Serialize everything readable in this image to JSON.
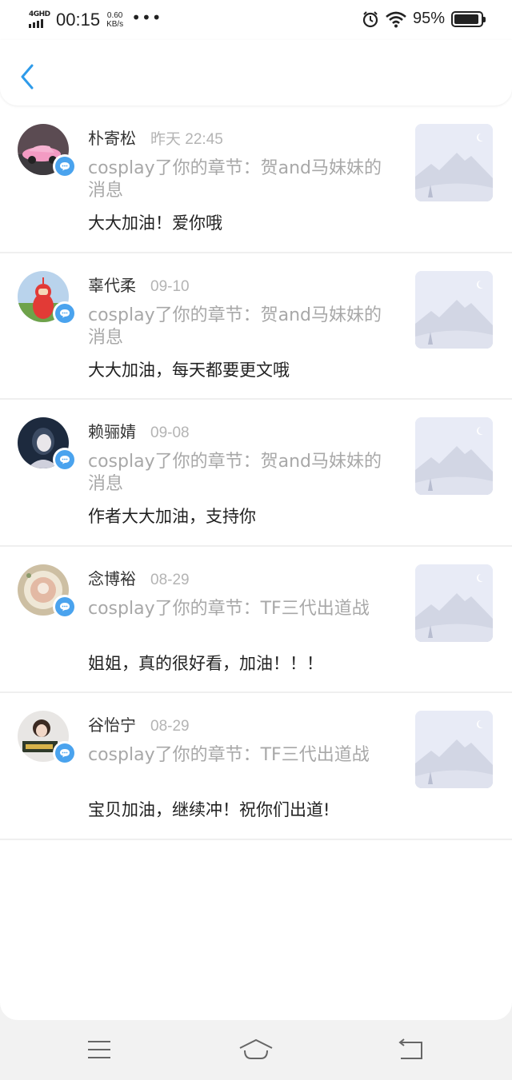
{
  "status_bar": {
    "network": "4GHD",
    "time": "00:15",
    "speed_value": "0.60",
    "speed_unit": "KB/s",
    "more": "•••",
    "battery": "95%",
    "battery_level": 0.95
  },
  "header": {
    "back_icon": "chevron-left-icon",
    "accent": "#2e9bea"
  },
  "messages": [
    {
      "name": "朴寄松",
      "date": "昨天 22:45",
      "ref": "cosplay了你的章节：贺and马妹妹的消息",
      "comment": "大大加油！爱你哦"
    },
    {
      "name": "辜代柔",
      "date": "09-10",
      "ref": "cosplay了你的章节：贺and马妹妹的消息",
      "comment": "大大加油，每天都要更文哦"
    },
    {
      "name": "赖骊婧",
      "date": "09-08",
      "ref": "cosplay了你的章节：贺and马妹妹的消息",
      "comment": "作者大大加油，支持你"
    },
    {
      "name": "念博裕",
      "date": "08-29",
      "ref": "cosplay了你的章节：TF三代出道战",
      "comment": "姐姐，真的很好看，加油！！！"
    },
    {
      "name": "谷怡宁",
      "date": "08-29",
      "ref": "cosplay了你的章节：TF三代出道战",
      "comment": "宝贝加油，继续冲！祝你们出道!"
    }
  ],
  "nav": {
    "menu_icon": "menu-icon",
    "home_icon": "home-icon",
    "back_icon": "back-icon"
  }
}
